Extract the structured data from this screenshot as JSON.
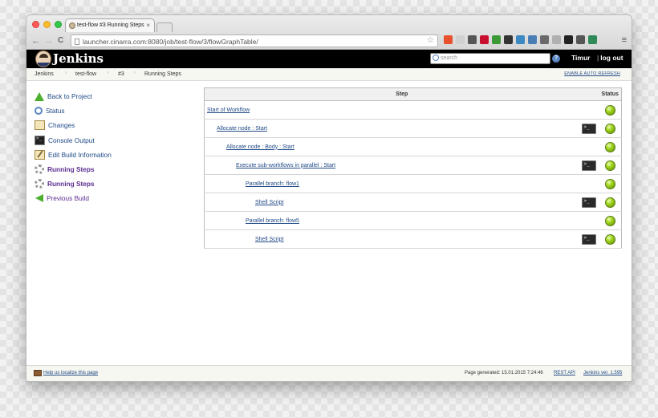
{
  "browser": {
    "tab_title": "test-flow #3 Running Steps",
    "tab_close": "×",
    "url": "launcher.cinarra.com:8080/job/test-flow/3/flowGraphTable/",
    "nav": {
      "back": "←",
      "forward": "→",
      "reload": "C"
    },
    "star": "☆",
    "menu": "≡",
    "extension_colors": [
      "#e8502e",
      "#d0d0d0",
      "#555555",
      "#c8102e",
      "#3b9a36",
      "#333333",
      "#3b88c3",
      "#4a7fb5",
      "#6a6a6a",
      "#b0b0b0",
      "#222222",
      "#555555",
      "#2e8b57"
    ]
  },
  "header": {
    "title": "Jenkins",
    "search_placeholder": "search",
    "help": "?",
    "user": "Timur",
    "logout_bar": "|",
    "logout": "log out"
  },
  "breadcrumbs": {
    "items": [
      "Jenkins",
      "test-flow",
      "#3",
      "Running Steps"
    ],
    "separator": "›",
    "auto_refresh": "ENABLE AUTO REFRESH"
  },
  "sidebar": {
    "items": [
      {
        "label": "Back to Project",
        "icon": "up-arrow-icon"
      },
      {
        "label": "Status",
        "icon": "search-icon"
      },
      {
        "label": "Changes",
        "icon": "notepad-icon"
      },
      {
        "label": "Console Output",
        "icon": "terminal-icon"
      },
      {
        "label": "Edit Build Information",
        "icon": "edit-notepad-icon"
      },
      {
        "label": "Running Steps",
        "icon": "gear-icon"
      },
      {
        "label": "Running Steps",
        "icon": "gear-icon"
      },
      {
        "label": "Previous Build",
        "icon": "left-arrow-icon"
      }
    ]
  },
  "table": {
    "header_step": "Step",
    "header_status": "Status",
    "rows": [
      {
        "step": "Start of Workflow",
        "indent": 0,
        "console": false,
        "status": "success"
      },
      {
        "step": "Allocate node : Start",
        "indent": 1,
        "console": true,
        "status": "success"
      },
      {
        "step": "Allocate node : Body : Start",
        "indent": 2,
        "console": false,
        "status": "success"
      },
      {
        "step": "Execute sub-workflows in parallel : Start",
        "indent": 3,
        "console": true,
        "status": "success"
      },
      {
        "step": "Parallel branch: flow1",
        "indent": 4,
        "console": false,
        "status": "success"
      },
      {
        "step": "Shell Script",
        "indent": 5,
        "console": true,
        "status": "success"
      },
      {
        "step": "Parallel branch: flow5",
        "indent": 4,
        "console": false,
        "status": "success"
      },
      {
        "step": "Shell Script",
        "indent": 5,
        "console": true,
        "status": "success"
      }
    ]
  },
  "footer": {
    "localize": "Help us localize this page",
    "generated": "Page generated: 15.01.2015 7:24:46",
    "rest_api": "REST API",
    "version": "Jenkins ver. 1.595"
  }
}
